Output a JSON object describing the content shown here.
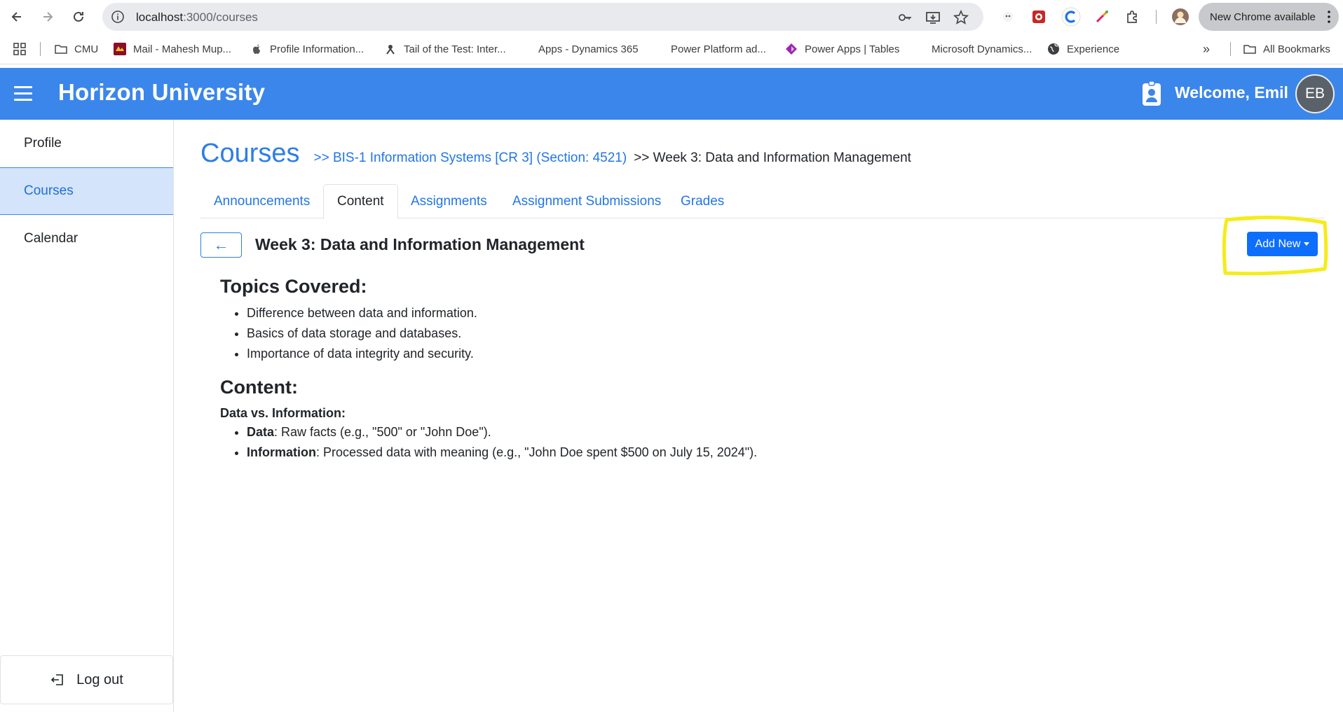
{
  "browser": {
    "url_host": "localhost",
    "url_path": ":3000/courses",
    "new_chrome_label": "New Chrome available",
    "bookmarks": [
      {
        "label": "CMU",
        "icon": "folder-icon"
      },
      {
        "label": "Mail - Mahesh Mup...",
        "icon": "cmu-mail-icon"
      },
      {
        "label": "Profile Information...",
        "icon": "apple-icon"
      },
      {
        "label": "Tail of the Test: Inter...",
        "icon": "test-icon"
      },
      {
        "label": "Apps - Dynamics 365",
        "icon": "microsoft-icon"
      },
      {
        "label": "Power Platform ad...",
        "icon": "microsoft-icon"
      },
      {
        "label": "Power Apps | Tables",
        "icon": "power-apps-icon"
      },
      {
        "label": "Microsoft Dynamics...",
        "icon": "microsoft-icon"
      },
      {
        "label": "Experience",
        "icon": "globe-icon"
      }
    ],
    "all_bookmarks_label": "All Bookmarks"
  },
  "header": {
    "brand": "Horizon University",
    "welcome": "Welcome, Emil",
    "avatar_initials": "EB",
    "color": "#3b86ea"
  },
  "sidebar": {
    "items": [
      {
        "label": "Profile"
      },
      {
        "label": "Courses",
        "active": true
      },
      {
        "label": "Calendar"
      }
    ],
    "logout_label": "Log out"
  },
  "breadcrumb": {
    "title": "Courses",
    "course": ">> BIS-1 Information Systems [CR 3] (Section: 4521)",
    "current": ">> Week 3: Data and Information Management"
  },
  "tabs": [
    {
      "label": "Announcements"
    },
    {
      "label": "Content",
      "active": true
    },
    {
      "label": "Assignments"
    },
    {
      "label": "Assignment Submissions"
    },
    {
      "label": "Grades"
    }
  ],
  "main": {
    "back_arrow": "←",
    "section_title": "Week 3: Data and Information Management",
    "add_new_label": "Add New",
    "topics_heading": "Topics Covered:",
    "topics": [
      "Difference between data and information.",
      "Basics of data storage and databases.",
      "Importance of data integrity and security."
    ],
    "content_heading": "Content:",
    "subheading": "Data vs. Information:",
    "definitions": [
      {
        "term": "Data",
        "text": ": Raw facts (e.g., \"500\" or \"John Doe\")."
      },
      {
        "term": "Information",
        "text": ": Processed data with meaning (e.g., \"John Doe spent $500 on July 15, 2024\")."
      }
    ]
  },
  "colors": {
    "accent": "#0d6efd",
    "link": "#2176e8",
    "highlight": "#f5ec1a",
    "sidebar_active_bg": "#d4e4fb"
  }
}
